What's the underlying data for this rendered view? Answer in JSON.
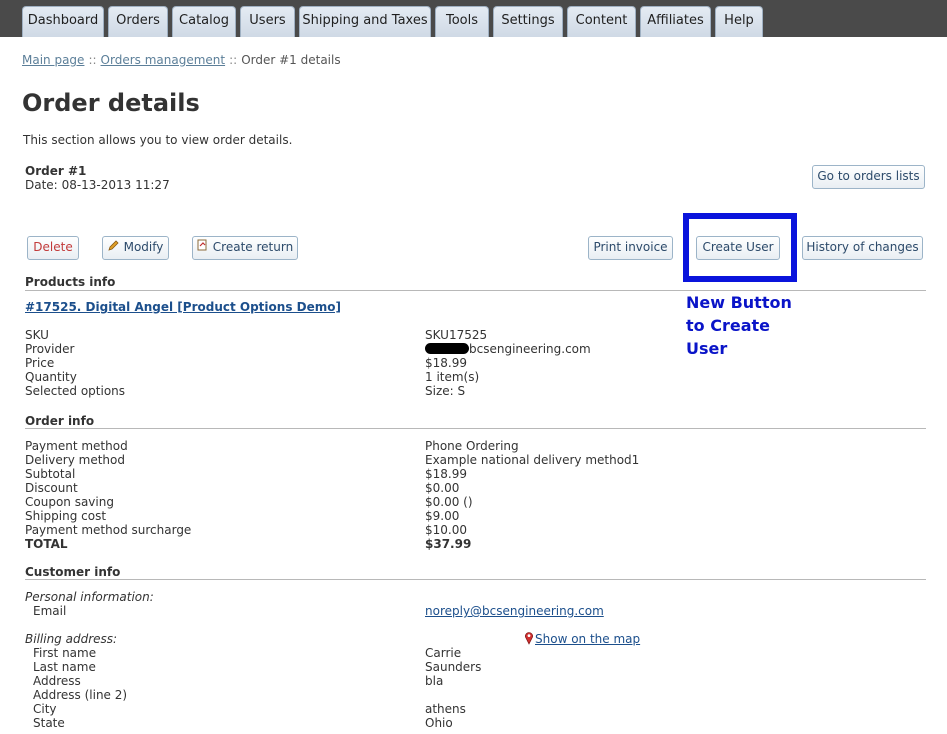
{
  "nav": {
    "tabs": [
      "Dashboard",
      "Orders",
      "Catalog",
      "Users",
      "Shipping and Taxes",
      "Tools",
      "Settings",
      "Content",
      "Affiliates",
      "Help"
    ]
  },
  "breadcrumb": {
    "items": [
      "Main page",
      "Orders management"
    ],
    "current": "Order #1 details",
    "separator": "::"
  },
  "page": {
    "title": "Order details",
    "description": "This section allows you to view order details."
  },
  "order": {
    "number": "Order #1",
    "date_label": "Date:",
    "date": "08-13-2013 11:27"
  },
  "buttons": {
    "goto_orders": "Go to orders lists",
    "delete": "Delete",
    "modify": "Modify",
    "create_return": "Create return",
    "print_invoice": "Print invoice",
    "create_user": "Create User",
    "history": "History of changes"
  },
  "annotation": {
    "lines": [
      "New Button",
      "to Create",
      "User"
    ],
    "color": "#0a14dc"
  },
  "products": {
    "section_title": "Products info",
    "product_link": "#17525. Digital Angel [Product Options Demo]",
    "rows": [
      {
        "label": "SKU",
        "value": "SKU17525"
      },
      {
        "label": "Provider",
        "value": "bcsengineering.com"
      },
      {
        "label": "Price",
        "value": "$18.99"
      },
      {
        "label": "Quantity",
        "value": "1 item(s)"
      },
      {
        "label": "Selected options",
        "value": "Size: S"
      }
    ]
  },
  "order_info": {
    "section_title": "Order info",
    "rows": [
      {
        "label": "Payment method",
        "value": "Phone Ordering"
      },
      {
        "label": "Delivery method",
        "value": "Example national delivery method1"
      },
      {
        "label": "Subtotal",
        "value": "$18.99"
      },
      {
        "label": "Discount",
        "value": "$0.00"
      },
      {
        "label": "Coupon saving",
        "value": "$0.00 ()"
      },
      {
        "label": "Shipping cost",
        "value": "$9.00"
      },
      {
        "label": "Payment method surcharge",
        "value": "$10.00"
      },
      {
        "label": "TOTAL",
        "value": "$37.99"
      }
    ]
  },
  "customer": {
    "section_title": "Customer info",
    "personal_heading": "Personal information:",
    "email_label": "Email",
    "email": "noreply@bcsengineering.com",
    "billing_heading": "Billing address:",
    "map_link": "Show on the map",
    "billing_rows": [
      {
        "label": "First name",
        "value": "Carrie"
      },
      {
        "label": "Last name",
        "value": "Saunders"
      },
      {
        "label": "Address",
        "value": "bla"
      },
      {
        "label": "Address (line 2)",
        "value": ""
      },
      {
        "label": "City",
        "value": "athens"
      },
      {
        "label": "State",
        "value": "Ohio"
      }
    ]
  }
}
